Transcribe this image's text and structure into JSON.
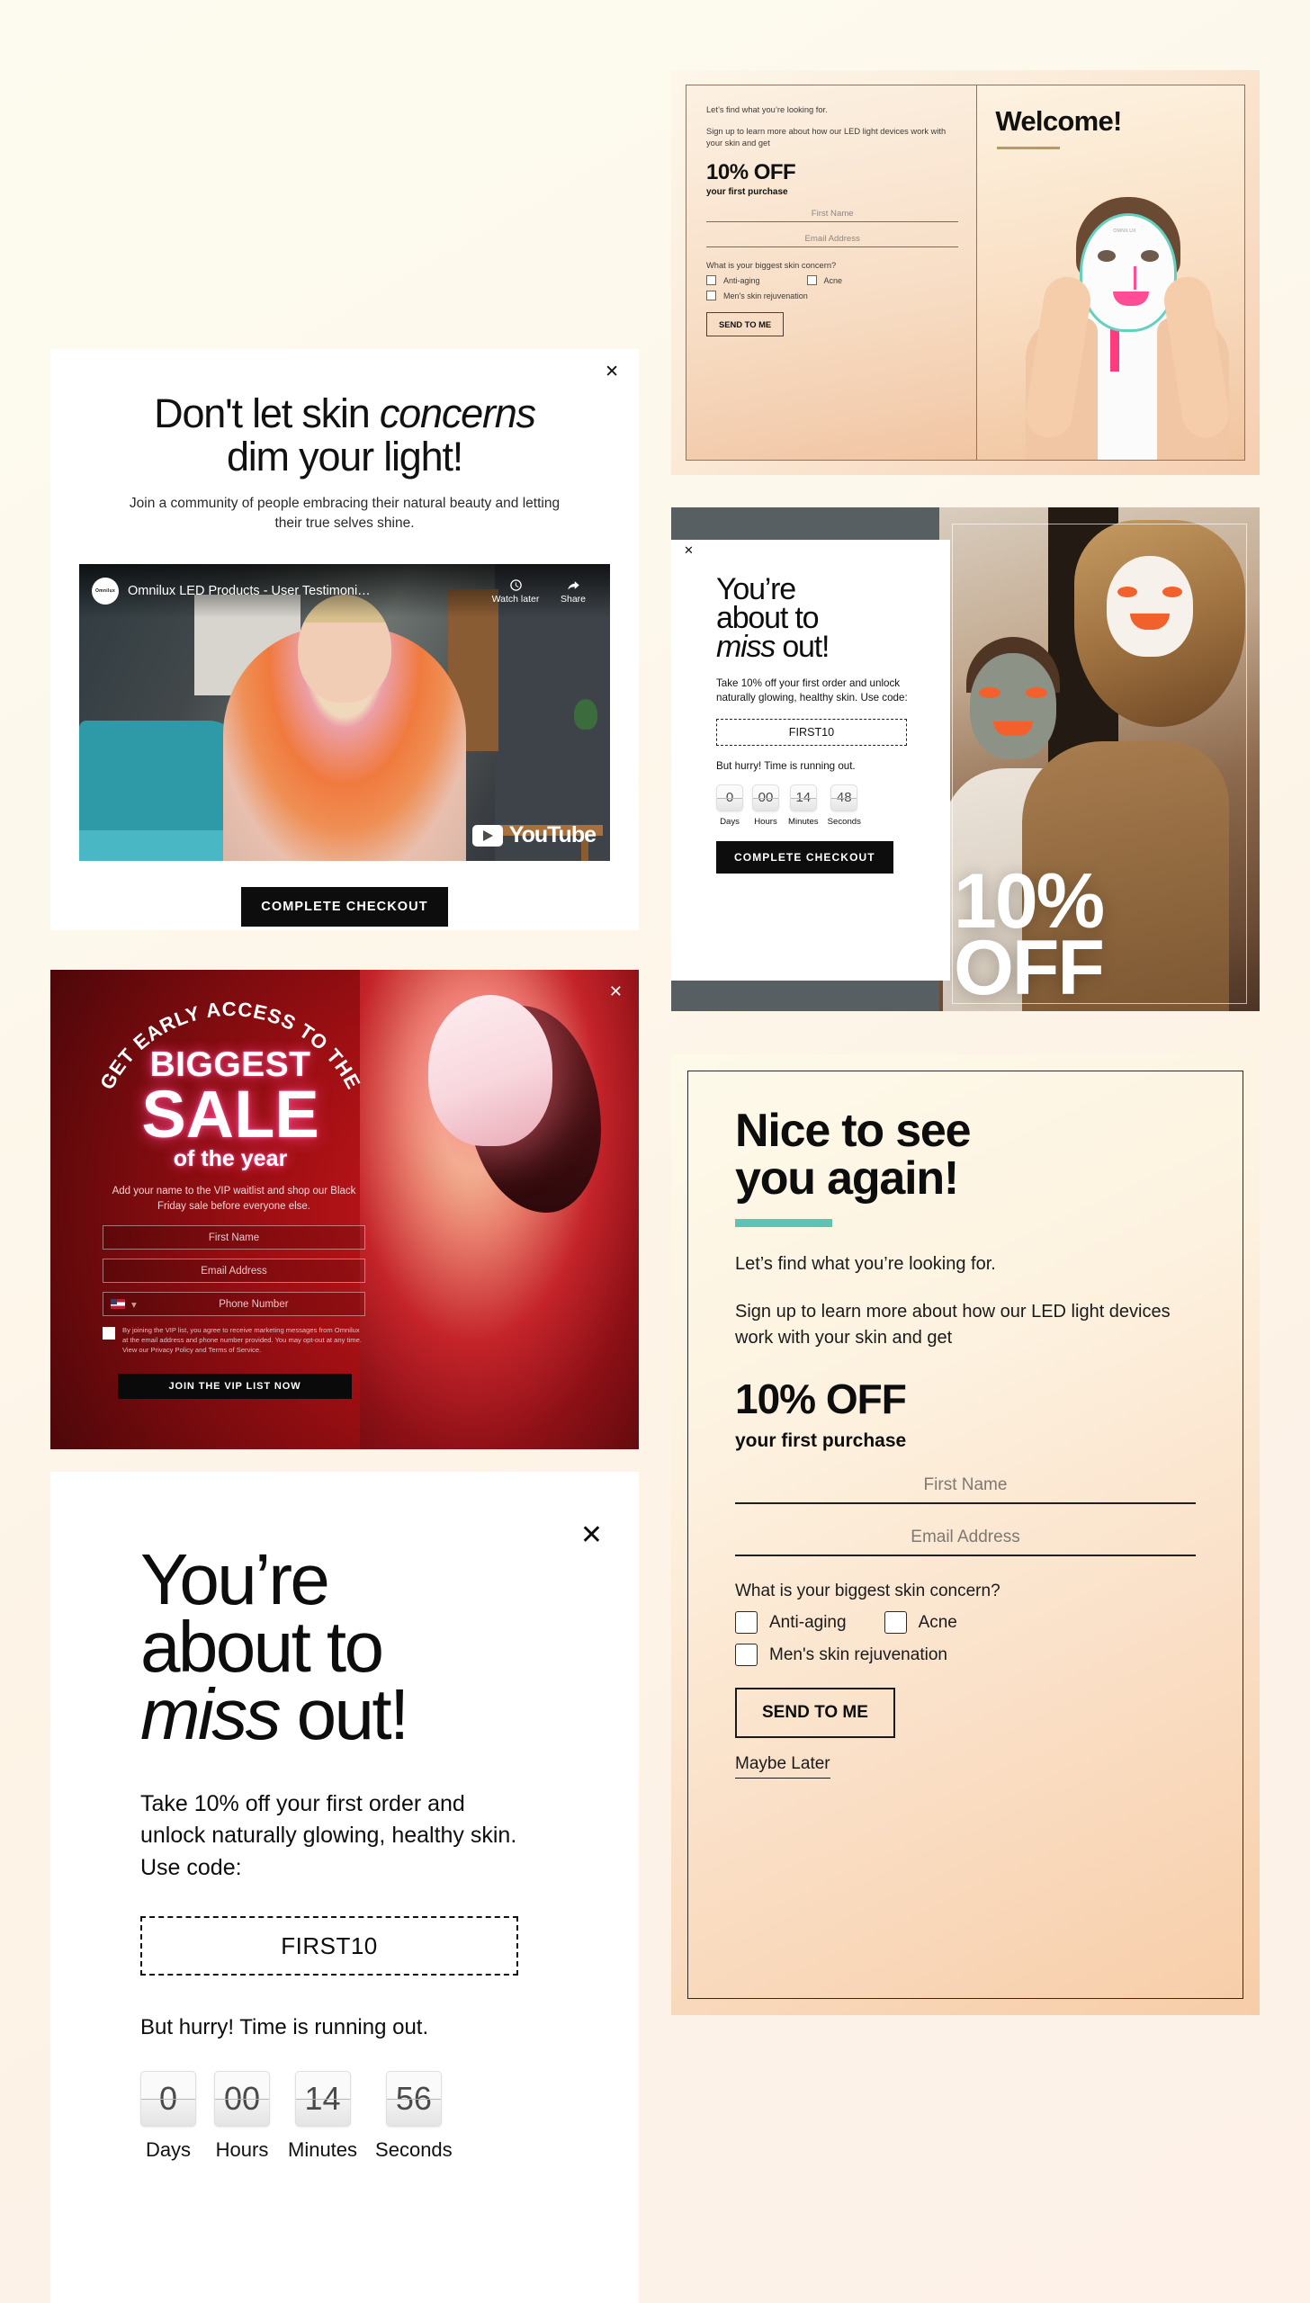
{
  "testimonial_modal": {
    "close_icon": "close-icon",
    "headline_part1": "Don't let skin ",
    "headline_em": "concerns",
    "headline_part2": "dim your light!",
    "subtext": "Join a community of people embracing their natural beauty and letting their true selves shine.",
    "video": {
      "title": "Omnilux LED Products - User Testimoni…",
      "channel": "Omnilux",
      "watch_later": "Watch later",
      "share": "Share",
      "brand": "YouTube"
    },
    "cta": "COMPLETE CHECKOUT"
  },
  "sale_modal": {
    "close_icon": "close-icon",
    "arch_text": "GET EARLY ACCESS TO THE",
    "biggest": "BIGGEST",
    "sale": "SALE",
    "of_the_year": "of the year",
    "description": "Add your name to the VIP waitlist and shop our Black Friday sale before everyone else.",
    "first_name_placeholder": "First Name",
    "email_placeholder": "Email Address",
    "phone_placeholder": "Phone Number",
    "country_flag": "us-flag-icon",
    "consent": "By joining the VIP list, you agree to receive marketing messages from Omnilux at the email address and phone number provided. You may opt-out at any time. View our Privacy Policy and Terms of Service.",
    "cta": "JOIN THE VIP LIST NOW"
  },
  "missout_large": {
    "close_icon": "close-icon",
    "headline_l1": "You’re",
    "headline_l2": "about to",
    "headline_em": "miss",
    "headline_l3_rest": " out!",
    "body": "Take 10% off your first order and unlock naturally glowing, healthy skin. Use code:",
    "code": "FIRST10",
    "hurry": "But hurry! Time is running out.",
    "countdown": [
      {
        "value": "0",
        "label": "Days"
      },
      {
        "value": "00",
        "label": "Hours"
      },
      {
        "value": "14",
        "label": "Minutes"
      },
      {
        "value": "56",
        "label": "Seconds"
      }
    ]
  },
  "welcome_modal": {
    "intro": "Let’s find what you’re looking for.",
    "signup": "Sign up to learn more about how our LED light devices work with your skin and get",
    "off": "10% OFF",
    "off_sub": "your first purchase",
    "first_name_placeholder": "First Name",
    "email_placeholder": "Email Address",
    "question": "What is your biggest skin concern?",
    "options": [
      "Anti-aging",
      "Acne",
      "Men's skin rejuvenation"
    ],
    "cta": "SEND TO ME",
    "welcome_title": "Welcome!",
    "product_logo": "OMNILUX"
  },
  "missout_small": {
    "close_icon": "close-icon",
    "headline_l1": "You’re",
    "headline_l2": "about to",
    "headline_em": "miss",
    "headline_l3_rest": " out!",
    "body": "Take 10% off your first order and unlock naturally glowing, healthy skin. Use code:",
    "code": "FIRST10",
    "hurry": "But hurry! Time is running out.",
    "countdown": [
      {
        "value": "0",
        "label": "Days"
      },
      {
        "value": "00",
        "label": "Hours"
      },
      {
        "value": "14",
        "label": "Minutes"
      },
      {
        "value": "48",
        "label": "Seconds"
      }
    ],
    "cta": "COMPLETE CHECKOUT",
    "overlay_line1": "10%",
    "overlay_line2": "OFF"
  },
  "nice_modal": {
    "headline_l1": "Nice to see",
    "headline_l2": "you again!",
    "intro": "Let’s find what you’re looking for.",
    "signup": "Sign up to learn more about how our LED light devices work with your skin and get",
    "off": "10% OFF",
    "off_sub": "your first purchase",
    "first_name_placeholder": "First Name",
    "email_placeholder": "Email Address",
    "question": "What is your biggest skin concern?",
    "options": [
      "Anti-aging",
      "Acne",
      "Men's skin rejuvenation"
    ],
    "cta": "SEND TO ME",
    "maybe_later": "Maybe Later",
    "accent_color": "#5ec2b5"
  }
}
